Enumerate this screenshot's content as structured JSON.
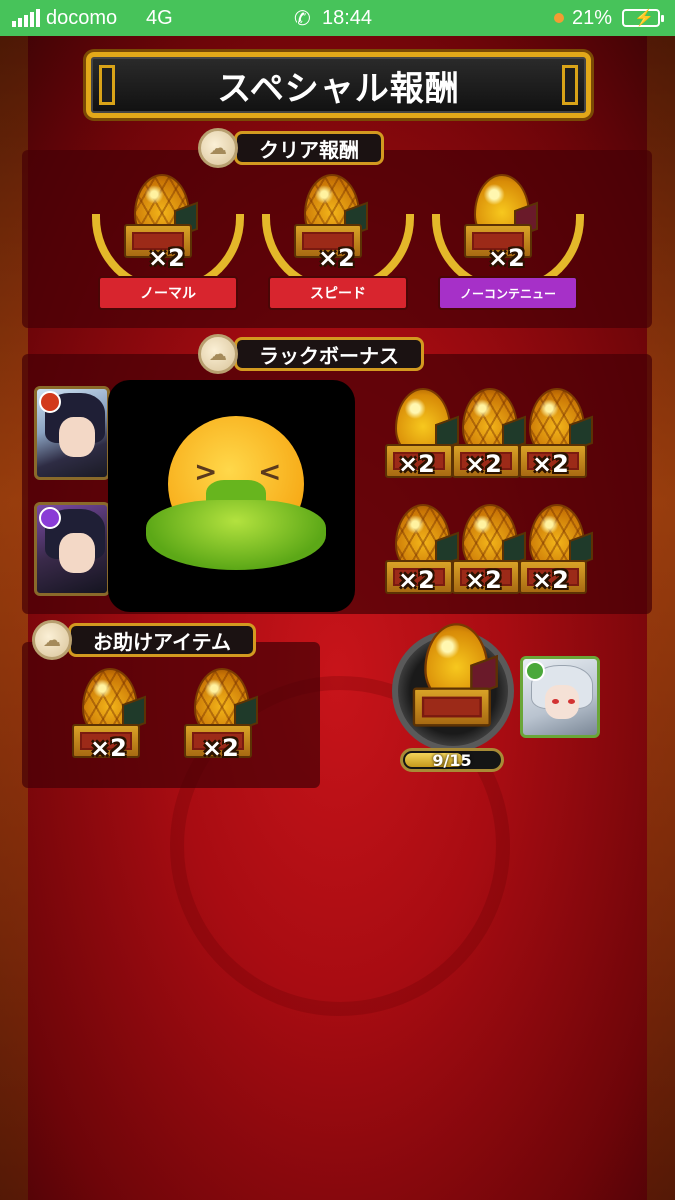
{
  "status_bar": {
    "carrier": "docomo",
    "network": "4G",
    "time": "18:44",
    "battery_percent": "21%",
    "signal_bars": 5
  },
  "title": "スペシャル報酬",
  "clear_rewards": {
    "header": "クリア報酬",
    "items": [
      {
        "multiplier": "×2",
        "label": "ノーマル",
        "ribbon_color": "#d8252e"
      },
      {
        "multiplier": "×2",
        "label": "スピード",
        "ribbon_color": "#d8252e"
      },
      {
        "multiplier": "×2",
        "label": "ノーコンテニュー",
        "ribbon_color": "#a630c8"
      }
    ]
  },
  "luck_bonus": {
    "header": "ラックボーナス",
    "eggs": [
      "×2",
      "×2",
      "×2",
      "×2",
      "×2",
      "×2"
    ]
  },
  "helper_items": {
    "header": "お助けアイテム",
    "eggs": [
      "×2",
      "×2"
    ]
  },
  "gauge": {
    "progress_text": "9/15",
    "progress_fraction": 0.6
  },
  "colors": {
    "status_bar": "#47c35a",
    "gold_border": "#d39a20",
    "background_red": "#a80c12"
  },
  "icons": {
    "emoji": "face-vomiting-icon",
    "coin": "medal-coin-icon"
  }
}
